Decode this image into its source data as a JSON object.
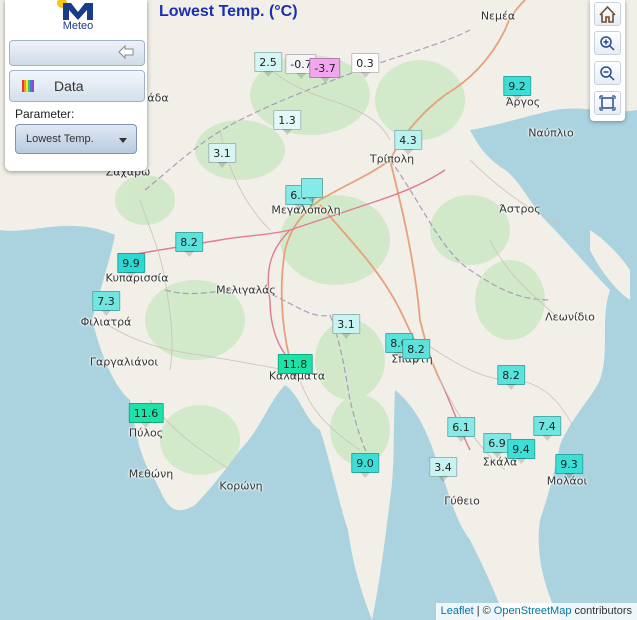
{
  "title": "Lowest Temp. (°C)",
  "logo": {
    "text": "Meteo",
    "accent": "#1a3b8a",
    "sun": "#f5c518"
  },
  "panel": {
    "data_button": "Data",
    "parameter_label": "Parameter:",
    "parameter_value": "Lowest Temp."
  },
  "toolbar": {
    "tools": [
      {
        "name": "home-icon"
      },
      {
        "name": "zoom-in-icon"
      },
      {
        "name": "zoom-out-icon"
      },
      {
        "name": "fullscreen-icon"
      }
    ]
  },
  "attribution": {
    "leaflet": "Leaflet",
    "sep": "| ©",
    "osm": "OpenStreetMap",
    "rest": "contributors"
  },
  "places": [
    {
      "name": "Νεμέα"
    },
    {
      "name": "Άργος"
    },
    {
      "name": "Ναύπλιο"
    },
    {
      "name": "Τρίπολη"
    },
    {
      "name": "Μεγαλόπολη"
    },
    {
      "name": "Άστρος"
    },
    {
      "name": "Κυπαρισσία"
    },
    {
      "name": "Φιλιατρά"
    },
    {
      "name": "Μελιγαλάς"
    },
    {
      "name": "Γαργαλιάνοι"
    },
    {
      "name": "Καλαμάτα"
    },
    {
      "name": "Σπάρτη"
    },
    {
      "name": "Λεωνίδιο"
    },
    {
      "name": "Πύλος"
    },
    {
      "name": "Μεθώνη"
    },
    {
      "name": "Κορώνη"
    },
    {
      "name": "Σκάλα"
    },
    {
      "name": "Γύθειο"
    },
    {
      "name": "Μολάοι"
    },
    {
      "name": "Ζαχάρω"
    },
    {
      "name": "Αμαλιάδα"
    }
  ],
  "stations": [
    {
      "value": "2.5",
      "color": "#d4f6f4"
    },
    {
      "value": "-0.7",
      "color": "#f4f4f4"
    },
    {
      "value": "-3.7",
      "color": "#f3a5f0"
    },
    {
      "value": "0.3",
      "color": "#ffffff"
    },
    {
      "value": "1.3",
      "color": "#e3f8f8"
    },
    {
      "value": "3.1",
      "color": "#d8f5f3"
    },
    {
      "value": "4.3",
      "color": "#b8f3f0"
    },
    {
      "value": "9.2",
      "color": "#3bdfd8"
    },
    {
      "value": "6.0",
      "color": "#86eae6"
    },
    {
      "value": "",
      "color": "#86eae6"
    },
    {
      "value": "8.2",
      "color": "#5ae3dd"
    },
    {
      "value": "9.9",
      "color": "#2ed8d2"
    },
    {
      "value": "7.3",
      "color": "#6fe6e1"
    },
    {
      "value": "3.1",
      "color": "#c8f3f1"
    },
    {
      "value": "8.0",
      "color": "#5ae3dd"
    },
    {
      "value": "8.2",
      "color": "#5ae3dd"
    },
    {
      "value": "11.8",
      "color": "#1de3a9"
    },
    {
      "value": "8.2",
      "color": "#5ae3dd"
    },
    {
      "value": "11.6",
      "color": "#1de3a9"
    },
    {
      "value": "6.1",
      "color": "#86eae6"
    },
    {
      "value": "7.4",
      "color": "#6fe6e1"
    },
    {
      "value": "6.9",
      "color": "#7fe8e3"
    },
    {
      "value": "9.4",
      "color": "#3bdfd8"
    },
    {
      "value": "9.0",
      "color": "#3bdfd8"
    },
    {
      "value": "3.4",
      "color": "#c8f3f1"
    },
    {
      "value": "9.3",
      "color": "#3bdfd8"
    }
  ]
}
